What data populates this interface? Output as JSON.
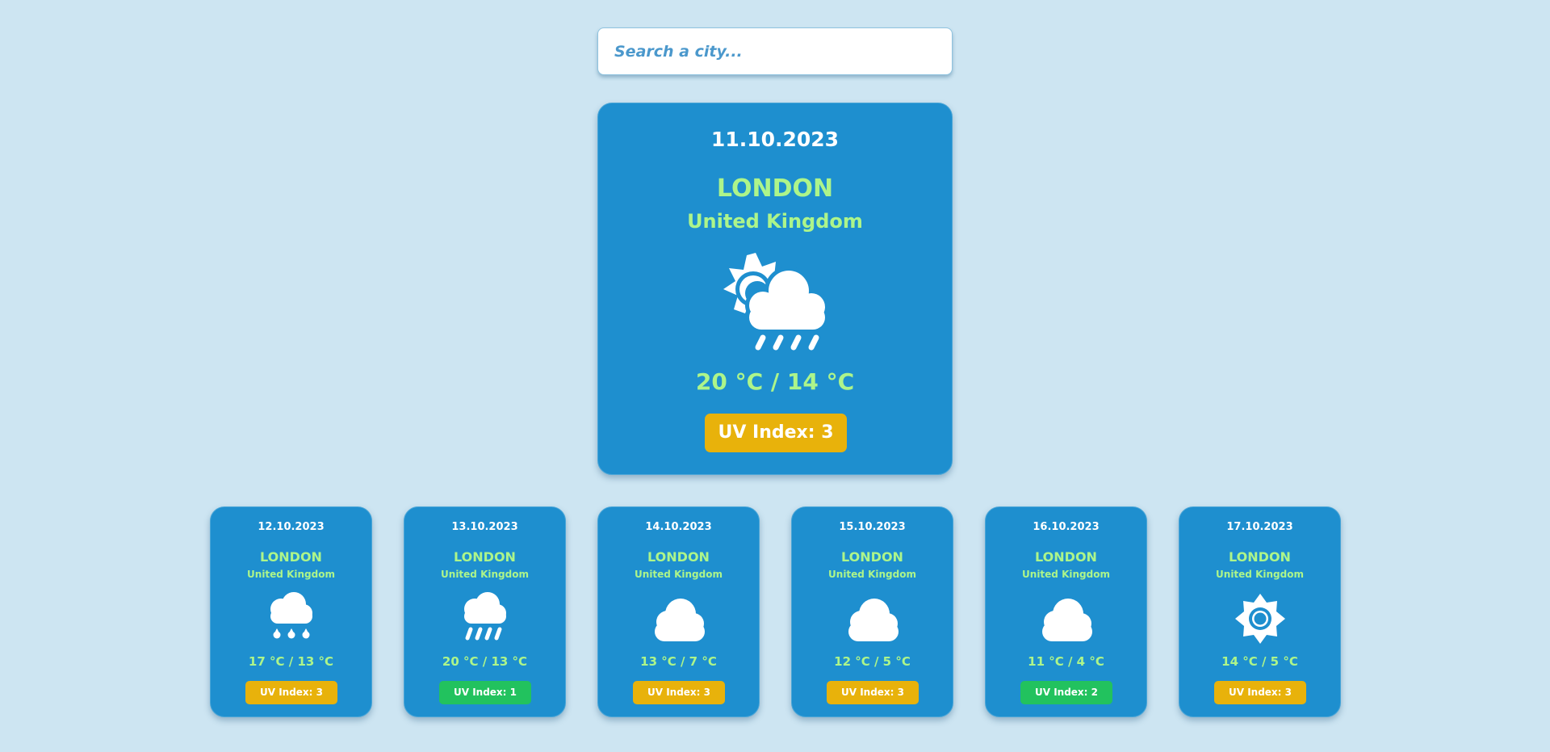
{
  "search": {
    "placeholder": "Search a city...",
    "value": ""
  },
  "colors": {
    "background": "#cde5f2",
    "card": "#1e8fcf",
    "accent_text": "#adf58a",
    "uv_moderate": "#e8b20b",
    "uv_low": "#22c25e"
  },
  "current": {
    "date": "11.10.2023",
    "city": "LONDON",
    "country": "United Kingdom",
    "icon": "sun-cloud-rain-icon",
    "temperature": "20 °C / 14 °C",
    "uv_label": "UV Index: 3",
    "uv_color": "#e8b20b"
  },
  "forecast": [
    {
      "date": "12.10.2023",
      "city": "LONDON",
      "country": "United Kingdom",
      "icon": "cloud-drizzle-icon",
      "temperature": "17 °C / 13 °C",
      "uv_label": "UV Index: 3",
      "uv_color": "#e8b20b"
    },
    {
      "date": "13.10.2023",
      "city": "LONDON",
      "country": "United Kingdom",
      "icon": "cloud-rain-icon",
      "temperature": "20 °C / 13 °C",
      "uv_label": "UV Index: 1",
      "uv_color": "#22c25e"
    },
    {
      "date": "14.10.2023",
      "city": "LONDON",
      "country": "United Kingdom",
      "icon": "cloud-icon",
      "temperature": "13 °C / 7 °C",
      "uv_label": "UV Index: 3",
      "uv_color": "#e8b20b"
    },
    {
      "date": "15.10.2023",
      "city": "LONDON",
      "country": "United Kingdom",
      "icon": "cloud-icon",
      "temperature": "12 °C / 5 °C",
      "uv_label": "UV Index: 3",
      "uv_color": "#e8b20b"
    },
    {
      "date": "16.10.2023",
      "city": "LONDON",
      "country": "United Kingdom",
      "icon": "cloud-icon",
      "temperature": "11 °C / 4 °C",
      "uv_label": "UV Index: 2",
      "uv_color": "#22c25e"
    },
    {
      "date": "17.10.2023",
      "city": "LONDON",
      "country": "United Kingdom",
      "icon": "sun-icon",
      "temperature": "14 °C / 5 °C",
      "uv_label": "UV Index: 3",
      "uv_color": "#e8b20b"
    }
  ]
}
